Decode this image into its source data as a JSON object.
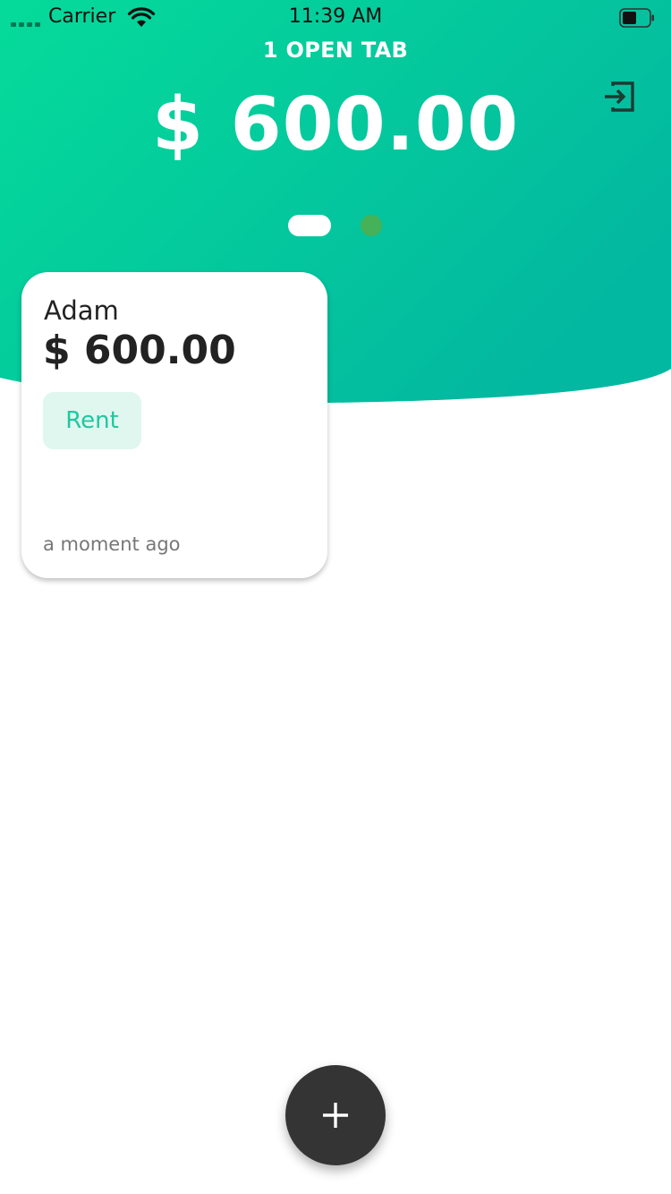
{
  "status_bar": {
    "carrier": "Carrier",
    "time": "11:39 AM"
  },
  "header": {
    "open_tabs_label": "1 OPEN TAB",
    "total_amount": "$ 600.00",
    "gradient_start": "#05db9a",
    "gradient_end": "#03b8a0"
  },
  "pager": {
    "pages": 2,
    "current_page": 1
  },
  "tabs": [
    {
      "name": "Adam",
      "amount": "$ 600.00",
      "tag": "Rent",
      "time": "a moment ago"
    }
  ],
  "icons": {
    "logout": "logout-icon",
    "add": "plus-icon"
  },
  "colors": {
    "accent": "#05db9a",
    "tag_bg": "#e0f7f0",
    "tag_text": "#1ec8a0",
    "fab": "#343434"
  }
}
